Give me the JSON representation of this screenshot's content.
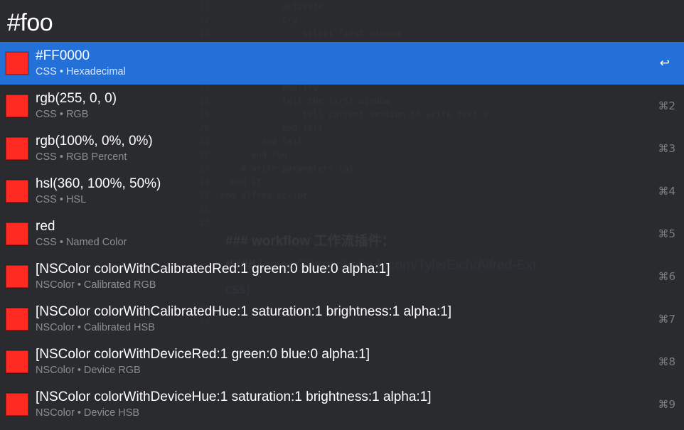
{
  "query": "#foo",
  "colors": {
    "swatch": "#FF2A22",
    "selection": "#2470D9"
  },
  "results": [
    {
      "title": "#FF0000",
      "subtitle": "CSS • Hexadecimal",
      "shortcut": "↩"
    },
    {
      "title": "rgb(255, 0, 0)",
      "subtitle": "CSS • RGB",
      "shortcut": "⌘2"
    },
    {
      "title": "rgb(100%, 0%, 0%)",
      "subtitle": "CSS • RGB Percent",
      "shortcut": "⌘3"
    },
    {
      "title": "hsl(360, 100%, 50%)",
      "subtitle": "CSS • HSL",
      "shortcut": "⌘4"
    },
    {
      "title": "red",
      "subtitle": "CSS • Named Color",
      "shortcut": "⌘5"
    },
    {
      "title": "[NSColor colorWithCalibratedRed:1 green:0 blue:0 alpha:1]",
      "subtitle": "NSColor • Calibrated RGB",
      "shortcut": "⌘6"
    },
    {
      "title": "[NSColor colorWithCalibratedHue:1 saturation:1 brightness:1 alpha:1]",
      "subtitle": "NSColor • Calibrated HSB",
      "shortcut": "⌘7"
    },
    {
      "title": "[NSColor colorWithDeviceRed:1 green:0 blue:0 alpha:1]",
      "subtitle": "NSColor • Device RGB",
      "shortcut": "⌘8"
    },
    {
      "title": "[NSColor colorWithDeviceHue:1 saturation:1 brightness:1 alpha:1]",
      "subtitle": "NSColor • Device HSB",
      "shortcut": "⌘9"
    }
  ]
}
